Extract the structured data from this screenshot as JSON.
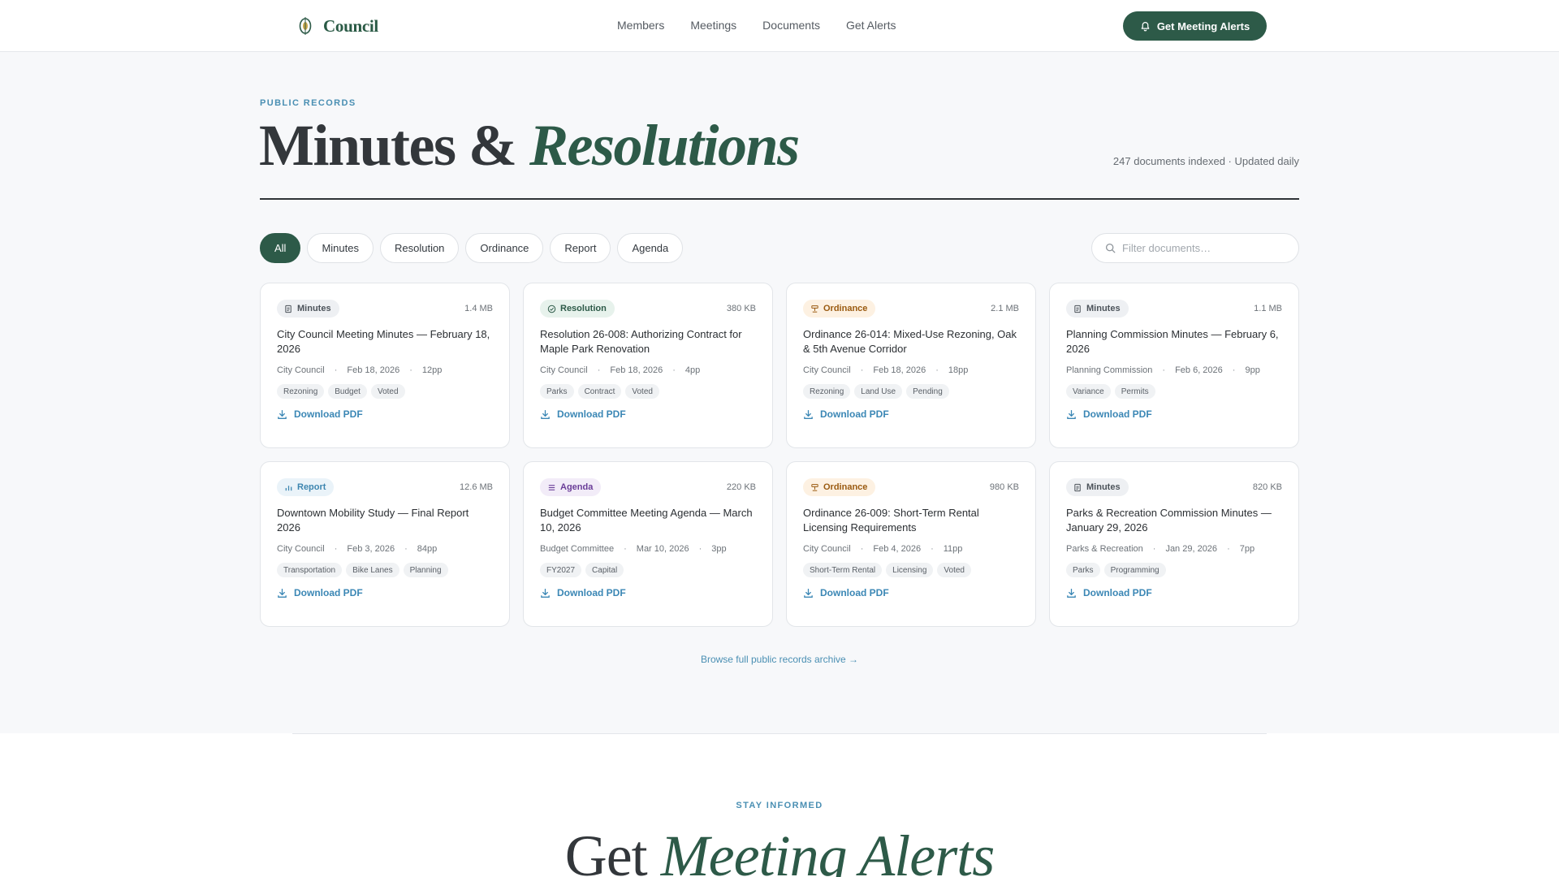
{
  "nav": {
    "brand": "Council",
    "links": [
      "Members",
      "Meetings",
      "Documents",
      "Get Alerts"
    ],
    "cta": "Get Meeting Alerts"
  },
  "header": {
    "eyebrow": "PUBLIC RECORDS",
    "title_plain": "Minutes & ",
    "title_accent": "Resolutions",
    "meta": "247 documents indexed · Updated daily"
  },
  "filters": {
    "chips": [
      "All",
      "Minutes",
      "Resolution",
      "Ordinance",
      "Report",
      "Agenda"
    ],
    "active": "All",
    "search_placeholder": "Filter documents…"
  },
  "cards": [
    {
      "type": "Minutes",
      "size": "1.4 MB",
      "title": "City Council Meeting Minutes — February 18, 2026",
      "body": "City Council",
      "date": "Feb 18, 2026",
      "pages": "12pp",
      "tags": [
        "Rezoning",
        "Budget",
        "Voted"
      ],
      "action": "Download PDF"
    },
    {
      "type": "Resolution",
      "size": "380 KB",
      "title": "Resolution 26-008: Authorizing Contract for Maple Park Renovation",
      "body": "City Council",
      "date": "Feb 18, 2026",
      "pages": "4pp",
      "tags": [
        "Parks",
        "Contract",
        "Voted"
      ],
      "action": "Download PDF"
    },
    {
      "type": "Ordinance",
      "size": "2.1 MB",
      "title": "Ordinance 26-014: Mixed-Use Rezoning, Oak & 5th Avenue Corridor",
      "body": "City Council",
      "date": "Feb 18, 2026",
      "pages": "18pp",
      "tags": [
        "Rezoning",
        "Land Use",
        "Pending"
      ],
      "action": "Download PDF"
    },
    {
      "type": "Minutes",
      "size": "1.1 MB",
      "title": "Planning Commission Minutes — February 6, 2026",
      "body": "Planning Commission",
      "date": "Feb 6, 2026",
      "pages": "9pp",
      "tags": [
        "Variance",
        "Permits"
      ],
      "action": "Download PDF"
    },
    {
      "type": "Report",
      "size": "12.6 MB",
      "title": "Downtown Mobility Study — Final Report 2026",
      "body": "City Council",
      "date": "Feb 3, 2026",
      "pages": "84pp",
      "tags": [
        "Transportation",
        "Bike Lanes",
        "Planning"
      ],
      "action": "Download PDF"
    },
    {
      "type": "Agenda",
      "size": "220 KB",
      "title": "Budget Committee Meeting Agenda — March 10, 2026",
      "body": "Budget Committee",
      "date": "Mar 10, 2026",
      "pages": "3pp",
      "tags": [
        "FY2027",
        "Capital"
      ],
      "action": "Download PDF"
    },
    {
      "type": "Ordinance",
      "size": "980 KB",
      "title": "Ordinance 26-009: Short-Term Rental Licensing Requirements",
      "body": "City Council",
      "date": "Feb 4, 2026",
      "pages": "11pp",
      "tags": [
        "Short-Term Rental",
        "Licensing",
        "Voted"
      ],
      "action": "Download PDF"
    },
    {
      "type": "Minutes",
      "size": "820 KB",
      "title": "Parks & Recreation Commission Minutes — January 29, 2026",
      "body": "Parks & Recreation",
      "date": "Jan 29, 2026",
      "pages": "7pp",
      "tags": [
        "Parks",
        "Programming"
      ],
      "action": "Download PDF"
    }
  ],
  "archive_link": "Browse full public records archive →",
  "alerts": {
    "eyebrow": "STAY INFORMED",
    "title_plain": "Get ",
    "title_accent": "Meeting Alerts"
  },
  "colors": {
    "brand_green": "#2d5a48",
    "link_blue": "#3b87b5",
    "page_bg": "#f7f8fa"
  },
  "icons": {
    "Minutes": "document-icon",
    "Resolution": "check-circle-icon",
    "Ordinance": "gavel-icon",
    "Report": "bar-chart-icon",
    "Agenda": "list-icon"
  }
}
